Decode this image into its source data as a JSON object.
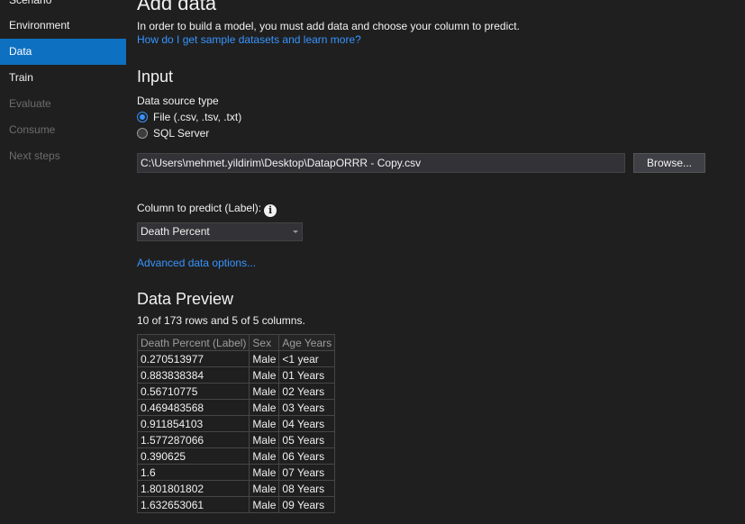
{
  "sidebar": {
    "items": [
      {
        "label": "Scenario"
      },
      {
        "label": "Environment"
      },
      {
        "label": "Data"
      },
      {
        "label": "Train"
      },
      {
        "label": "Evaluate"
      },
      {
        "label": "Consume"
      },
      {
        "label": "Next steps"
      }
    ]
  },
  "header": {
    "title": "Add data",
    "description": "In order to build a model, you must add data and choose your column to predict.",
    "help_link": "How do I get sample datasets and learn more?"
  },
  "input": {
    "section_title": "Input",
    "source_type_label": "Data source type",
    "options": [
      {
        "label": "File (.csv, .tsv, .txt)",
        "checked": true
      },
      {
        "label": "SQL Server",
        "checked": false
      }
    ],
    "path_value": "C:\\Users\\mehmet.yildirim\\Desktop\\DatapORRR - Copy.csv",
    "browse_label": "Browse..."
  },
  "label_column": {
    "label": "Column to predict (Label):",
    "info_glyph": "i",
    "selected": "Death Percent",
    "advanced_link": "Advanced data options..."
  },
  "preview": {
    "section_title": "Data Preview",
    "summary": "10 of 173 rows and 5 of 5 columns.",
    "columns": [
      "Death Percent (Label)",
      "Sex",
      "Age Years"
    ],
    "rows": [
      [
        "0.270513977",
        "Male",
        "<1 year"
      ],
      [
        "0.883838384",
        "Male",
        "01 Years"
      ],
      [
        "0.56710775",
        "Male",
        "02 Years"
      ],
      [
        "0.469483568",
        "Male",
        "03 Years"
      ],
      [
        "0.911854103",
        "Male",
        "04 Years"
      ],
      [
        "1.577287066",
        "Male",
        "05 Years"
      ],
      [
        "0.390625",
        "Male",
        "06 Years"
      ],
      [
        "1.6",
        "Male",
        "07 Years"
      ],
      [
        "1.801801802",
        "Male",
        "08 Years"
      ],
      [
        "1.632653061",
        "Male",
        "09 Years"
      ]
    ]
  },
  "colors": {
    "accent": "#0e70c0",
    "link": "#3794ff",
    "background": "#1f1f1f"
  }
}
